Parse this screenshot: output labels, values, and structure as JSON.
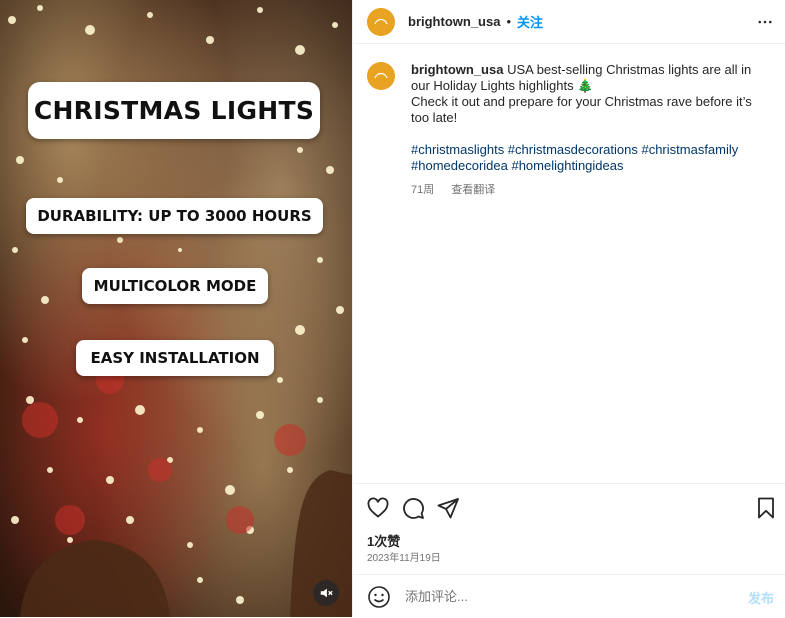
{
  "media": {
    "title_label": "CHRISTMAS LIGHTS",
    "features": [
      "DURABILITY: UP TO 3000 HOURS",
      "MULTICOLOR MODE",
      "EASY INSTALLATION"
    ],
    "mute_icon": "speaker-muted-icon"
  },
  "header": {
    "username": "brightown_usa",
    "separator": "•",
    "follow_label": "关注",
    "more_icon": "more-horizontal-icon"
  },
  "avatar": {
    "brand_color": "#e9a323"
  },
  "caption": {
    "username": "brightown_usa",
    "line1": "USA best-selling Christmas lights are all in our Holiday Lights highlights 🎄",
    "line2": "Check it out and prepare for your Christmas rave before it’s too late!",
    "hashtags": "#christmaslights #christmasdecorations #christmasfamily #homedecoridea #homelightingideas",
    "age": "71周",
    "translate": "查看翻译"
  },
  "actions": {
    "like_icon": "heart-icon",
    "comment_icon": "comment-icon",
    "share_icon": "send-icon",
    "save_icon": "bookmark-icon"
  },
  "likes": "1次赞",
  "date": "2023年11月19日",
  "comment": {
    "placeholder": "添加评论...",
    "post_label": "发布",
    "emoji_icon": "emoji-icon"
  },
  "colors": {
    "link": "#00376b",
    "accent": "#0095f6",
    "post_disabled": "#b2dffc"
  }
}
